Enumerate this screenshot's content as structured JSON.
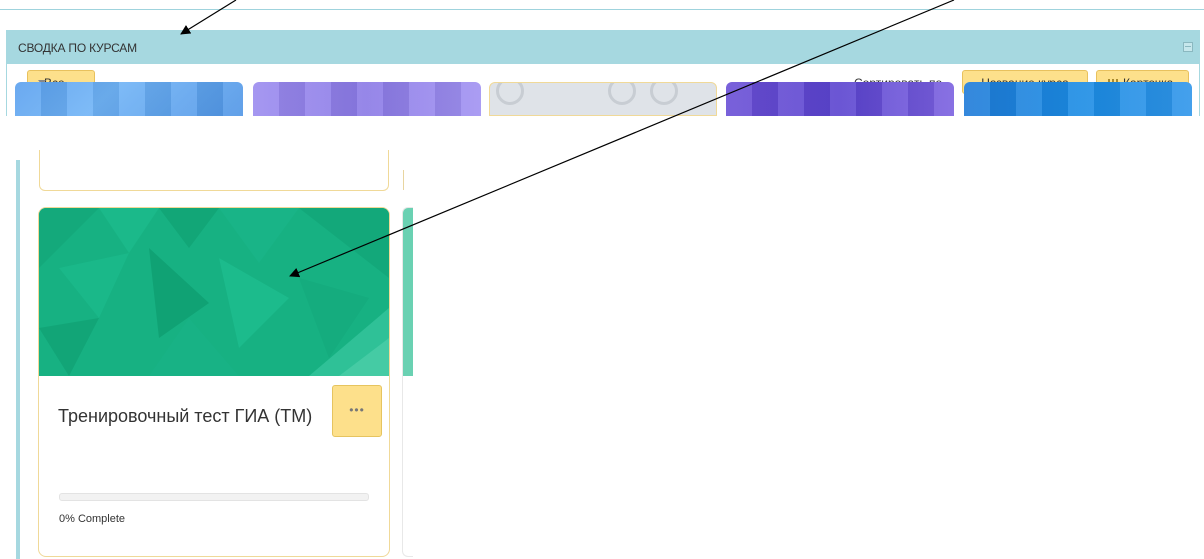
{
  "block": {
    "title": "СВОДКА ПО КУРСАМ",
    "filter_label": "Все",
    "sort_label": "Сортировать по",
    "sort_button": "Название курса",
    "view_button": "Карточка"
  },
  "course": {
    "title": "Тренировочный тест ГИА (ТМ)",
    "more_label": "•••",
    "progress_percent": 0,
    "progress_text": "0% Complete"
  },
  "colors": {
    "header_bg": "#a6d8e0",
    "button_yellow": "#fde08b",
    "course_image": "#17b182"
  },
  "icons": [
    "filter-icon",
    "grid-icon",
    "collapse-icon",
    "more-icon"
  ]
}
